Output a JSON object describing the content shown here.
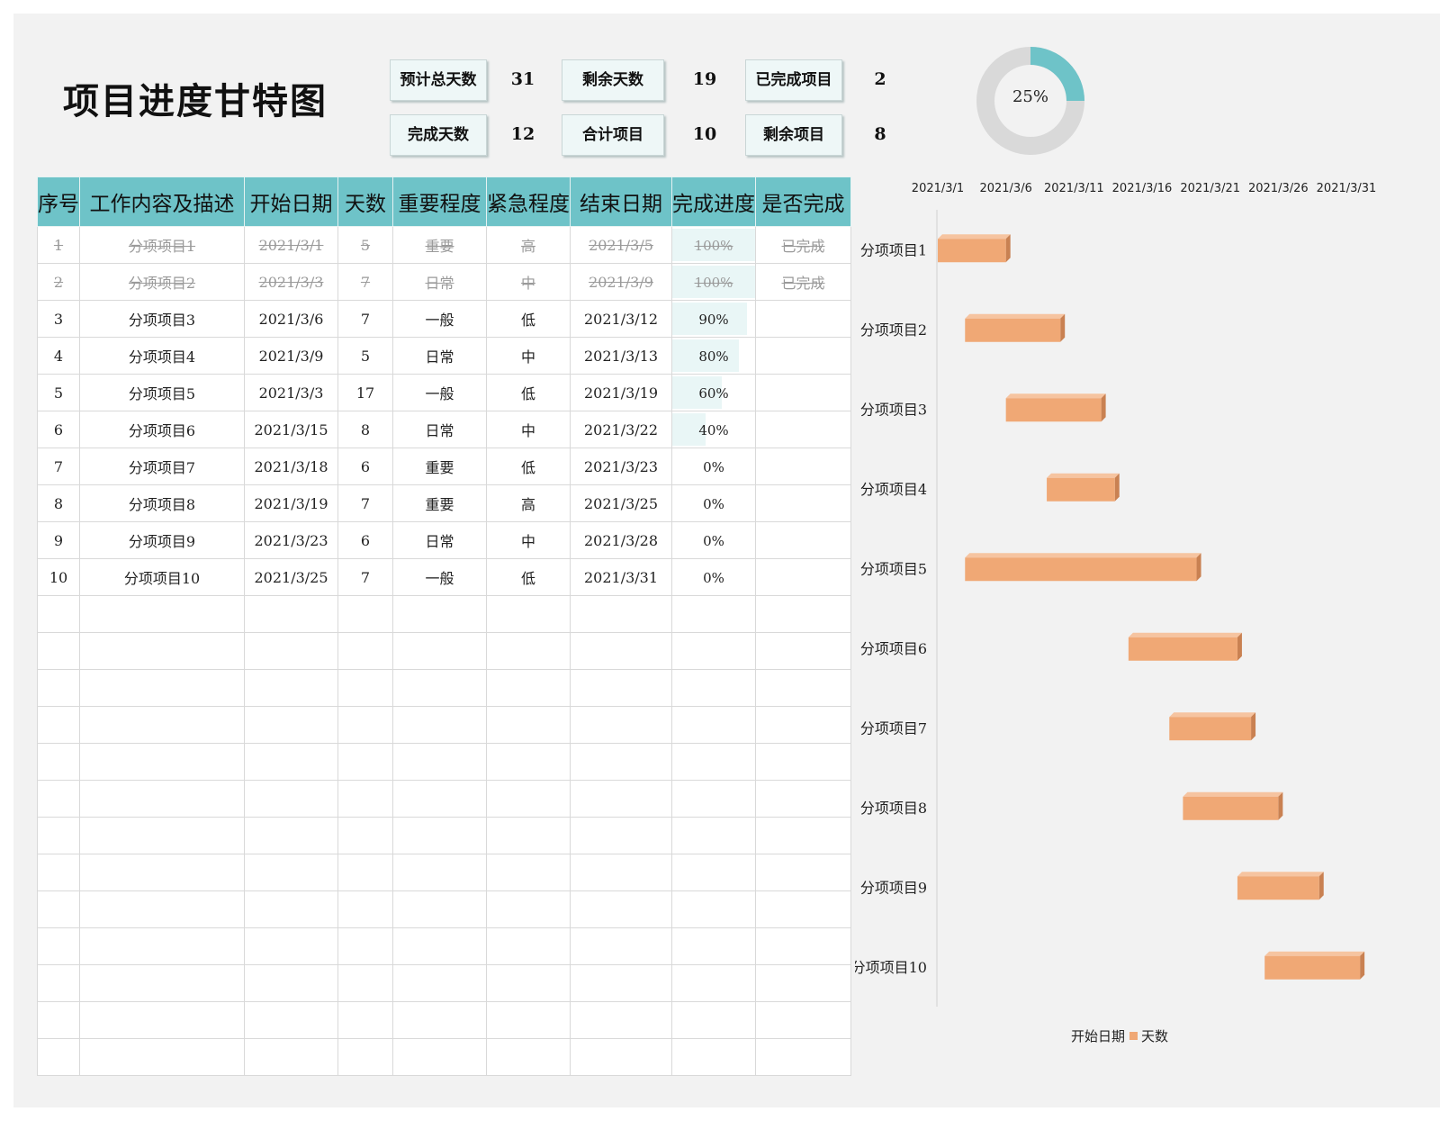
{
  "title": "项目进度甘特图",
  "stats": [
    {
      "label": "预计总天数",
      "value": "31"
    },
    {
      "label": "剩余天数",
      "value": "19"
    },
    {
      "label": "已完成项目",
      "value": "2"
    },
    {
      "label": "完成天数",
      "value": "12"
    },
    {
      "label": "合计项目",
      "value": "10"
    },
    {
      "label": "剩余项目",
      "value": "8"
    }
  ],
  "donut": {
    "label": "25%",
    "fraction": 0.25,
    "fill_color": "#6ec3c8",
    "track_color": "#d9d9d9"
  },
  "table": {
    "headers": [
      "序号",
      "工作内容及描述",
      "开始日期",
      "天数",
      "重要程度",
      "紧急程度",
      "结束日期",
      "完成进度",
      "是否完成"
    ],
    "rows": [
      {
        "no": "1",
        "task": "分项项目1",
        "start": "2021/3/1",
        "days": "5",
        "importance": "重要",
        "urgency": "高",
        "end": "2021/3/5",
        "progress": "100%",
        "progress_value": 1.0,
        "status": "已完成"
      },
      {
        "no": "2",
        "task": "分项项目2",
        "start": "2021/3/3",
        "days": "7",
        "importance": "日常",
        "urgency": "中",
        "end": "2021/3/9",
        "progress": "100%",
        "progress_value": 1.0,
        "status": "已完成"
      },
      {
        "no": "3",
        "task": "分项项目3",
        "start": "2021/3/6",
        "days": "7",
        "importance": "一般",
        "urgency": "低",
        "end": "2021/3/12",
        "progress": "90%",
        "progress_value": 0.9,
        "status": ""
      },
      {
        "no": "4",
        "task": "分项项目4",
        "start": "2021/3/9",
        "days": "5",
        "importance": "日常",
        "urgency": "中",
        "end": "2021/3/13",
        "progress": "80%",
        "progress_value": 0.8,
        "status": ""
      },
      {
        "no": "5",
        "task": "分项项目5",
        "start": "2021/3/3",
        "days": "17",
        "importance": "一般",
        "urgency": "低",
        "end": "2021/3/19",
        "progress": "60%",
        "progress_value": 0.6,
        "status": ""
      },
      {
        "no": "6",
        "task": "分项项目6",
        "start": "2021/3/15",
        "days": "8",
        "importance": "日常",
        "urgency": "中",
        "end": "2021/3/22",
        "progress": "40%",
        "progress_value": 0.4,
        "status": ""
      },
      {
        "no": "7",
        "task": "分项项目7",
        "start": "2021/3/18",
        "days": "6",
        "importance": "重要",
        "urgency": "低",
        "end": "2021/3/23",
        "progress": "0%",
        "progress_value": 0.0,
        "status": ""
      },
      {
        "no": "8",
        "task": "分项项目8",
        "start": "2021/3/19",
        "days": "7",
        "importance": "重要",
        "urgency": "高",
        "end": "2021/3/25",
        "progress": "0%",
        "progress_value": 0.0,
        "status": ""
      },
      {
        "no": "9",
        "task": "分项项目9",
        "start": "2021/3/23",
        "days": "6",
        "importance": "日常",
        "urgency": "中",
        "end": "2021/3/28",
        "progress": "0%",
        "progress_value": 0.0,
        "status": ""
      },
      {
        "no": "10",
        "task": "分项项目10",
        "start": "2021/3/25",
        "days": "7",
        "importance": "一般",
        "urgency": "低",
        "end": "2021/3/31",
        "progress": "0%",
        "progress_value": 0.0,
        "status": ""
      }
    ],
    "blank_rows": 13
  },
  "chart_data": {
    "type": "bar",
    "orientation": "horizontal",
    "stacked": true,
    "categories": [
      "分项项目1",
      "分项项目2",
      "分项项目3",
      "分项项目4",
      "分项项目5",
      "分项项目6",
      "分项项目7",
      "分项项目8",
      "分项项目9",
      "分项项目10"
    ],
    "series": [
      {
        "name": "开始日期",
        "values": [
          "2021/3/1",
          "2021/3/3",
          "2021/3/6",
          "2021/3/9",
          "2021/3/3",
          "2021/3/15",
          "2021/3/18",
          "2021/3/19",
          "2021/3/23",
          "2021/3/25"
        ],
        "visible": false
      },
      {
        "name": "天数",
        "values": [
          5,
          7,
          7,
          5,
          17,
          8,
          6,
          7,
          6,
          7
        ],
        "color": "#f0a875"
      }
    ],
    "x_ticks": [
      "2021/3/1",
      "2021/3/6",
      "2021/3/11",
      "2021/3/16",
      "2021/3/21",
      "2021/3/26",
      "2021/3/31"
    ],
    "xlim": [
      "2021/3/1",
      "2021/3/31"
    ],
    "x_axis_position": "top",
    "legend_position": "bottom",
    "grid": false
  }
}
